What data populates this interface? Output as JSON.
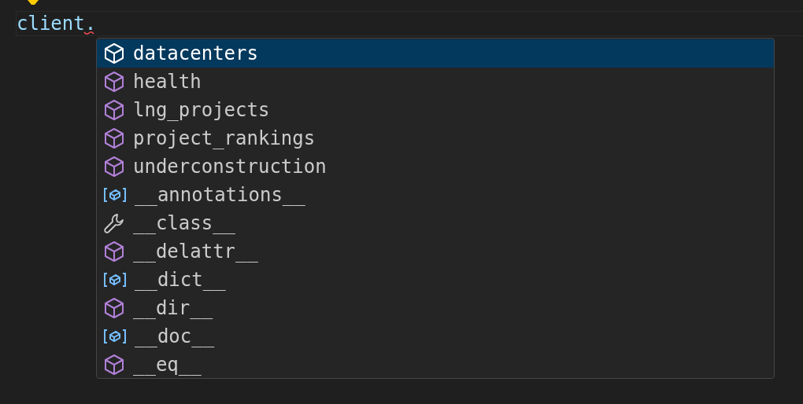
{
  "editor": {
    "line_text": "client.",
    "has_error": true
  },
  "suggestions": [
    {
      "label": "datacenters",
      "kind": "method",
      "selected": true
    },
    {
      "label": "health",
      "kind": "method",
      "selected": false
    },
    {
      "label": "lng_projects",
      "kind": "method",
      "selected": false
    },
    {
      "label": "project_rankings",
      "kind": "method",
      "selected": false
    },
    {
      "label": "underconstruction",
      "kind": "method",
      "selected": false
    },
    {
      "label": "__annotations__",
      "kind": "variable",
      "selected": false
    },
    {
      "label": "__class__",
      "kind": "property",
      "selected": false
    },
    {
      "label": "__delattr__",
      "kind": "method",
      "selected": false
    },
    {
      "label": "__dict__",
      "kind": "variable",
      "selected": false
    },
    {
      "label": "__dir__",
      "kind": "method",
      "selected": false
    },
    {
      "label": "__doc__",
      "kind": "variable",
      "selected": false
    },
    {
      "label": "__eq__",
      "kind": "method",
      "selected": false
    }
  ]
}
